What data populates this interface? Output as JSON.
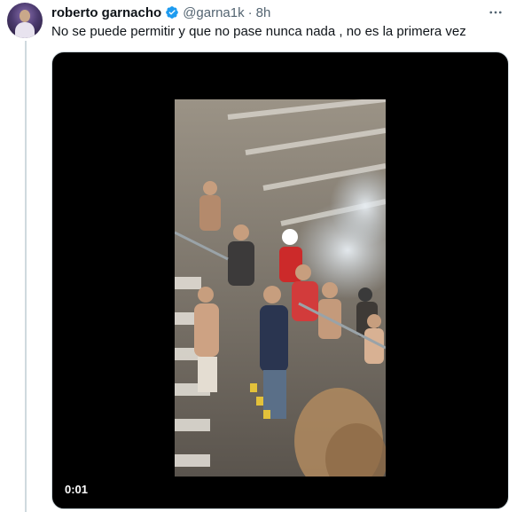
{
  "tweet": {
    "author_name": "roberto garnacho",
    "handle": "@garna1k",
    "separator": "·",
    "time": "8h",
    "text": "No se puede permitir y que no pase nunca nada , no es la primera vez",
    "verified_color": "#1d9bf0"
  },
  "media": {
    "type": "video",
    "timestamp": "0:01"
  },
  "icons": {
    "avatar": "profile-avatar",
    "verified": "verified-badge-icon",
    "more": "more-options-icon"
  }
}
